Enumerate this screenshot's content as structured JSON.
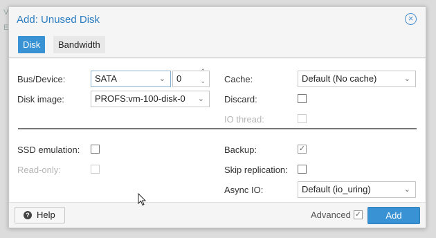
{
  "background": {
    "text_1": "V",
    "text_2": "E"
  },
  "dialog": {
    "title": "Add: Unused Disk",
    "close_icon": "close-circle-icon"
  },
  "tabs": [
    {
      "label": "Disk",
      "active": true
    },
    {
      "label": "Bandwidth",
      "active": false
    }
  ],
  "form": {
    "bus_device": {
      "label": "Bus/Device:",
      "bus_value": "SATA",
      "device_value": "0"
    },
    "disk_image": {
      "label": "Disk image:",
      "value": "PROFS:vm-100-disk-0"
    },
    "cache": {
      "label": "Cache:",
      "value": "Default (No cache)"
    },
    "discard": {
      "label": "Discard:",
      "checked": false
    },
    "io_thread": {
      "label": "IO thread:",
      "checked": false,
      "disabled": true
    },
    "ssd_emulation": {
      "label": "SSD emulation:",
      "checked": false
    },
    "read_only": {
      "label": "Read-only:",
      "checked": false,
      "disabled": true
    },
    "backup": {
      "label": "Backup:",
      "checked": true
    },
    "skip_replication": {
      "label": "Skip replication:",
      "checked": false
    },
    "async_io": {
      "label": "Async IO:",
      "value": "Default (io_uring)"
    }
  },
  "footer": {
    "help_label": "Help",
    "advanced_label": "Advanced",
    "advanced_checked": true,
    "add_label": "Add"
  },
  "colors": {
    "accent": "#3892d4",
    "title": "#2a7bbf"
  }
}
